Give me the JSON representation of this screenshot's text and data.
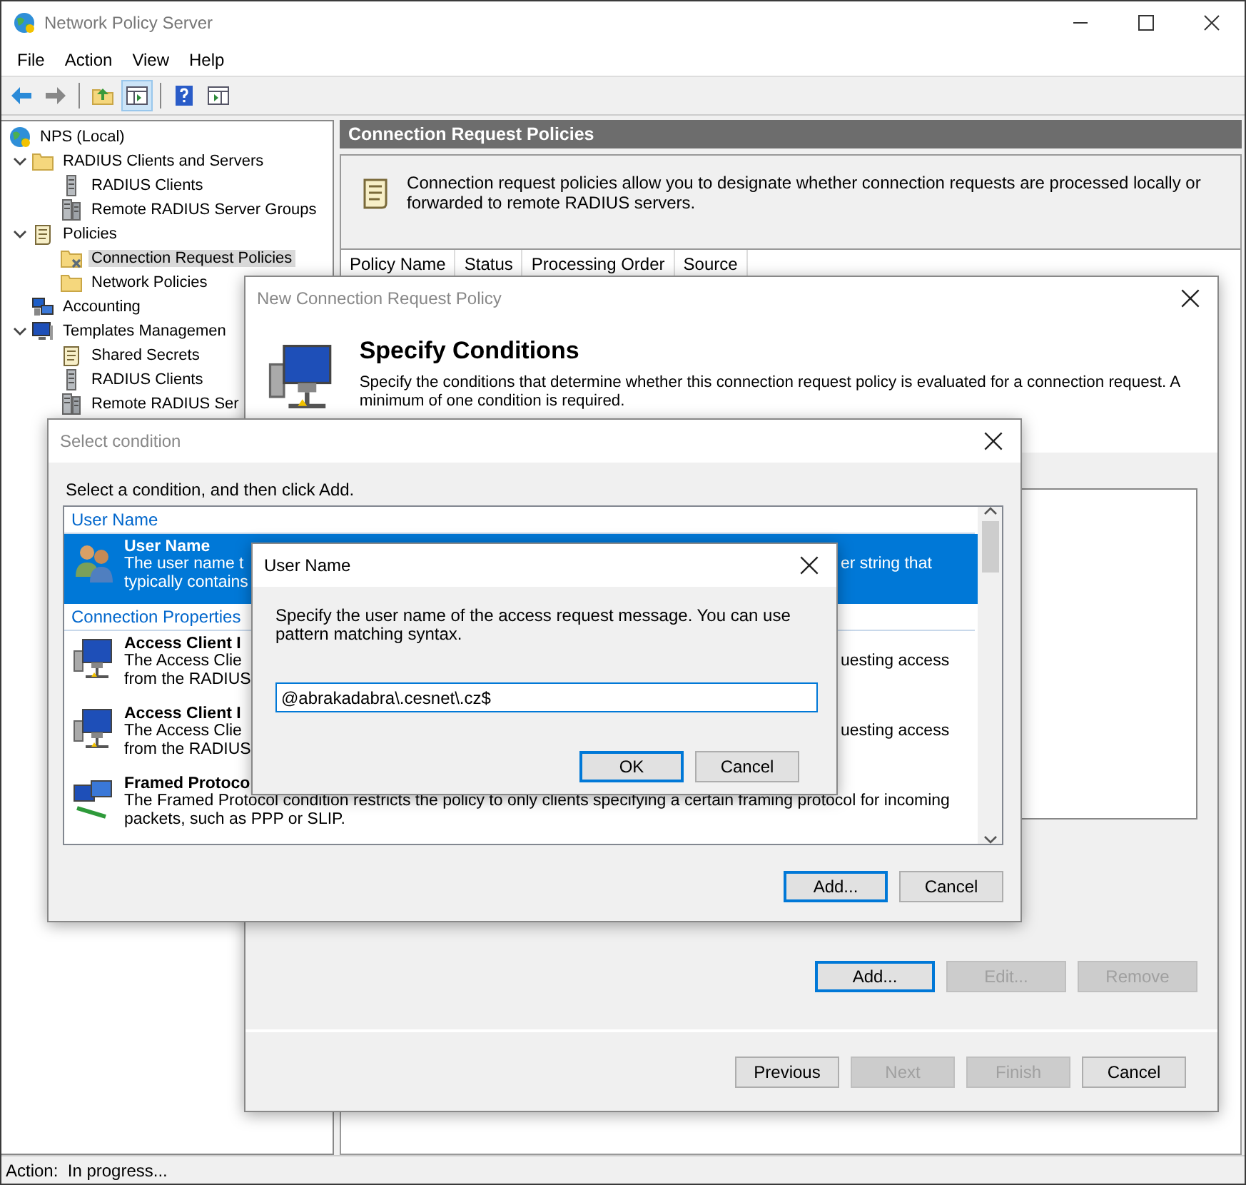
{
  "window": {
    "title": "Network Policy Server"
  },
  "menu": [
    "File",
    "Action",
    "View",
    "Help"
  ],
  "toolbar": [
    {
      "kind": "back",
      "pressed": false
    },
    {
      "kind": "forward",
      "pressed": false
    },
    {
      "kind": "separator"
    },
    {
      "kind": "up",
      "pressed": false
    },
    {
      "kind": "tree",
      "pressed": true
    },
    {
      "kind": "separator"
    },
    {
      "kind": "help",
      "pressed": false
    },
    {
      "kind": "pane",
      "pressed": false
    }
  ],
  "tree": [
    {
      "label": "NPS (Local)",
      "kind": "globe",
      "selected": false,
      "children": [
        {
          "label": "RADIUS Clients and Servers",
          "kind": "folder",
          "expanded": true,
          "selected": false,
          "children": [
            {
              "label": "RADIUS Clients",
              "kind": "server",
              "selected": false
            },
            {
              "label": "Remote RADIUS Server Groups",
              "kind": "servers",
              "selected": false
            }
          ]
        },
        {
          "label": "Policies",
          "kind": "scroll",
          "expanded": true,
          "selected": false,
          "children": [
            {
              "label": "Connection Request Policies",
              "kind": "policy-folder",
              "selected": true
            },
            {
              "label": "Network Policies",
              "kind": "folder",
              "selected": false
            }
          ]
        },
        {
          "label": "Accounting",
          "kind": "computers",
          "selected": false
        },
        {
          "label": "Templates Managemen",
          "kind": "monitor",
          "expanded": true,
          "selected": false,
          "children": [
            {
              "label": "Shared Secrets",
              "kind": "scroll",
              "selected": false
            },
            {
              "label": "RADIUS Clients",
              "kind": "server",
              "selected": false
            },
            {
              "label": "Remote RADIUS Ser",
              "kind": "servers",
              "selected": false
            }
          ]
        }
      ]
    }
  ],
  "details": {
    "title": "Connection Request Policies",
    "description": "Connection request policies allow you to designate whether connection requests are processed locally or forwarded to remote RADIUS servers.",
    "columns": [
      "Policy Name",
      "Status",
      "Processing Order",
      "Source"
    ]
  },
  "wizard": {
    "title": "New Connection Request Policy",
    "heading": "Specify Conditions",
    "description": "Specify the conditions that determine whether this connection request policy is evaluated for a connection request. A minimum of one condition is required.",
    "buttons": [
      {
        "label": "Add...",
        "focused": true,
        "disabled": false
      },
      {
        "label": "Edit...",
        "focused": false,
        "disabled": true
      },
      {
        "label": "Remove",
        "focused": false,
        "disabled": true
      }
    ],
    "nav_buttons": [
      {
        "label": "Previous",
        "focused": false,
        "disabled": false
      },
      {
        "label": "Next",
        "focused": false,
        "disabled": true
      },
      {
        "label": "Finish",
        "focused": false,
        "disabled": true
      },
      {
        "label": "Cancel",
        "focused": false,
        "disabled": false
      }
    ]
  },
  "select_condition": {
    "title": "Select condition",
    "prompt": "Select a condition, and then click Add.",
    "groups": [
      {
        "label": "User Name",
        "items": [
          {
            "title": "User Name",
            "kind": "users",
            "selected": true,
            "lines": [
              [
                "The user name t",
                "er string that"
              ],
              [
                "typically contains"
              ]
            ]
          }
        ]
      },
      {
        "label": "Connection Properties",
        "items": [
          {
            "title": "Access Client I",
            "kind": "network-computer",
            "selected": false,
            "lines": [
              [
                "The Access Clie",
                "uesting access"
              ],
              [
                "from the RADIUS"
              ]
            ]
          },
          {
            "title": "Access Client I",
            "kind": "network-computer",
            "selected": false,
            "lines": [
              [
                "The Access Clie",
                "uesting access"
              ],
              [
                "from the RADIUS"
              ]
            ]
          },
          {
            "title": "Framed Protoco",
            "kind": "computers-link",
            "selected": false,
            "lines": [
              [
                "The Framed Protocol condition restricts the policy to only clients specifying a certain framing protocol for incoming"
              ],
              [
                "packets, such as PPP or SLIP."
              ]
            ]
          }
        ]
      }
    ],
    "buttons": [
      {
        "label": "Add...",
        "focused": true,
        "disabled": false
      },
      {
        "label": "Cancel",
        "focused": false,
        "disabled": false
      }
    ]
  },
  "user_name_dialog": {
    "title": "User Name",
    "description": "Specify the user name of the access request message. You can use pattern matching syntax.",
    "value": "@abrakadabra\\.cesnet\\.cz$",
    "buttons": [
      {
        "label": "OK",
        "focused": true,
        "disabled": false
      },
      {
        "label": "Cancel",
        "focused": false,
        "disabled": false
      }
    ]
  },
  "status_bar": "Action:  In progress..."
}
